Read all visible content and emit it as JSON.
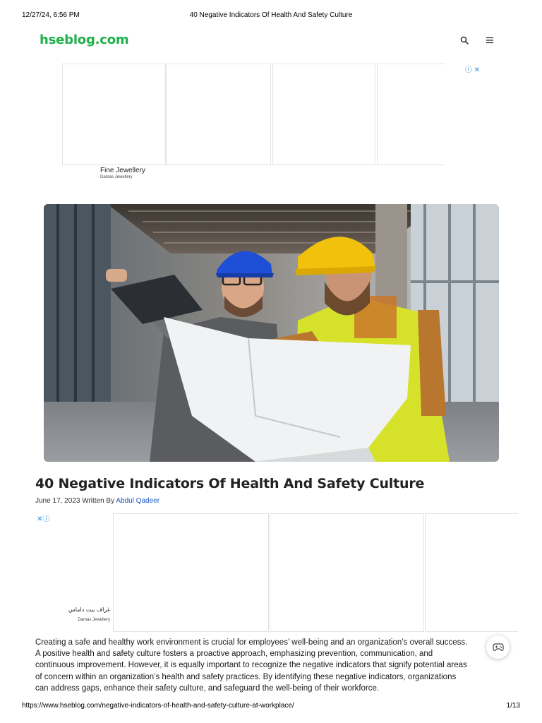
{
  "print": {
    "date": "12/27/24, 6:56 PM",
    "title": "40 Negative Indicators Of Health And Safety Culture",
    "url": "https://www.hseblog.com/negative-indicators-of-health-and-safety-culture-at-workplace/",
    "page": "1/13"
  },
  "site": {
    "logo": "hseblog.com",
    "brand_color": "#1eb14a",
    "search_icon": "search-icon",
    "menu_icon": "menu-icon"
  },
  "ad_top": {
    "title": "Fine Jewellery",
    "advertiser": "Damas Jewellery",
    "icons": "ⓘ ✕"
  },
  "hero_image": {
    "alt": "Two construction workers in hard hats reviewing blueprints"
  },
  "article": {
    "title": "40 Negative Indicators Of Health And Safety Culture",
    "date_prefix": "June 17, 2023 Written By ",
    "author": "Abdul Qadeer",
    "intro_lines": [
      "Creating a safe and healthy work environment is crucial for employees’ well-being and an organization’s overall success.",
      "A positive health and safety culture fosters a proactive approach, emphasizing prevention, communication, and",
      "continuous improvement. However, it is equally important to recognize the negative indicators that signify potential areas",
      "of concern within an organization’s health and safety practices. By identifying these negative indicators, organizations",
      "can address gaps, enhance their safety culture, and safeguard the well-being of their workforce."
    ]
  },
  "ad_mid": {
    "close_icons": "✕ⓘ",
    "title": "غراف بيت داماس",
    "advertiser": "Damas Jewellery"
  }
}
